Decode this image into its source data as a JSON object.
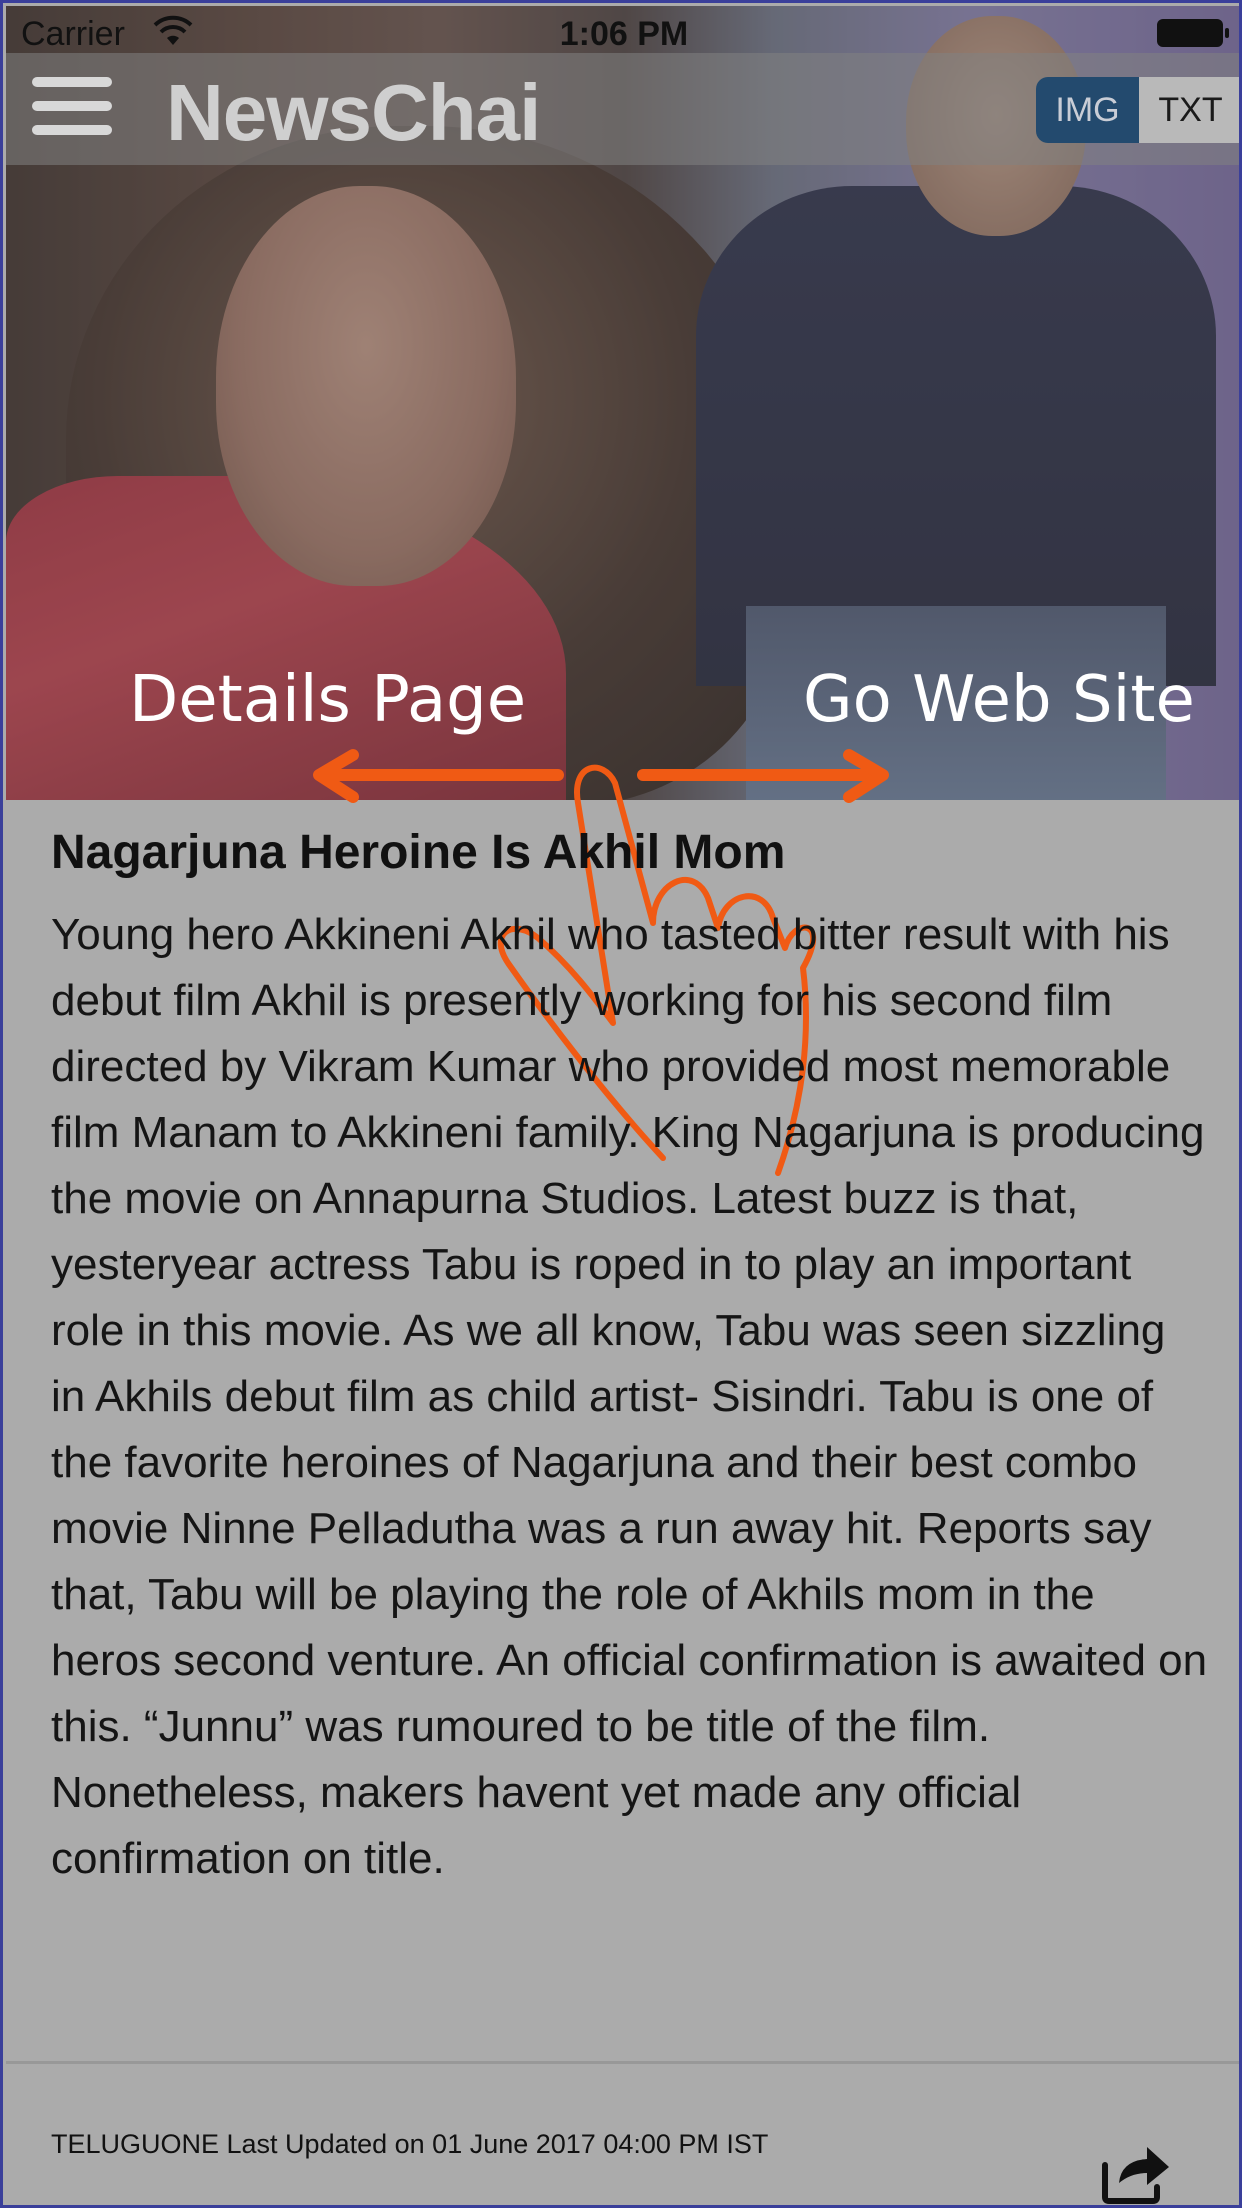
{
  "status_bar": {
    "carrier": "Carrier",
    "time": "1:06 PM"
  },
  "navbar": {
    "logo": "NewsChai",
    "toggle": {
      "img_label": "IMG",
      "txt_label": "TXT",
      "selected": "IMG"
    }
  },
  "gesture_hints": {
    "left": "Details Page",
    "right": "Go Web Site"
  },
  "article": {
    "title": "Nagarjuna Heroine Is Akhil Mom",
    "body": "Young hero Akkineni Akhil who tasted bitter result with his debut film Akhil is presently working for his second film directed by Vikram Kumar who provided most memorable film Manam to Akkineni family. King Nagarjuna is producing the movie on Annapurna Studios. Latest buzz is that, yesteryear actress Tabu is roped in to play an important role in this movie. As we all know, Tabu was seen sizzling in Akhils debut film as child artist- Sisindri. Tabu is one of the favorite heroines of Nagarjuna and their best combo movie Ninne Pelladutha was a run away hit. Reports say that, Tabu will be playing the role of Akhils mom in the heros second venture. An official confirmation is awaited on this. “Junnu” was rumoured to be title of the film. Nonetheless, makers havent yet made any official confirmation on title."
  },
  "footer": {
    "meta": "TELUGUONE Last Updated on 01 June 2017 04:00 PM IST"
  },
  "colors": {
    "gesture_orange": "#f05a14",
    "toggle_active": "#234a6e",
    "overlay_bg": "#ababab"
  },
  "icons": {
    "menu": "hamburger-icon",
    "share": "share-icon",
    "gesture": "swipe-hand-icon"
  }
}
